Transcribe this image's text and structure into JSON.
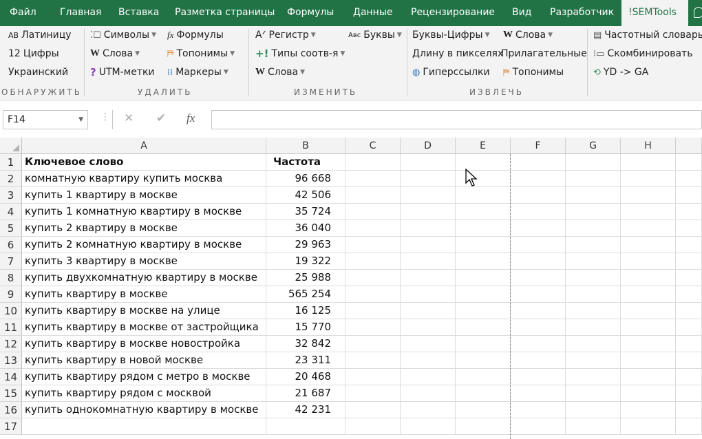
{
  "menu": {
    "tabs": [
      {
        "label": "Файл"
      },
      {
        "label": "Главная"
      },
      {
        "label": "Вставка"
      },
      {
        "label": "Разметка страницы"
      },
      {
        "label": "Формулы"
      },
      {
        "label": "Данные"
      },
      {
        "label": "Рецензирование"
      },
      {
        "label": "Вид"
      },
      {
        "label": "Разработчик"
      },
      {
        "label": "!SEMTools"
      }
    ],
    "active_tab": "!SEMTools"
  },
  "ribbon": {
    "groups": [
      {
        "title": "ОБНАРУЖИТЬ"
      },
      {
        "title": "УДАЛИТЬ"
      },
      {
        "title": "ИЗМЕНИТЬ"
      },
      {
        "title": "ИЗВЛЕЧЬ"
      }
    ],
    "buttons": [
      {
        "label": "Латиницу",
        "icon": "АВ"
      },
      {
        "label": "Цифры",
        "icon": "12"
      },
      {
        "label": "Украинский"
      },
      {
        "label": "Символы",
        "icon": "квадрат"
      },
      {
        "label": "Слова",
        "icon": "W"
      },
      {
        "label": "UTM-метки",
        "icon": "?"
      },
      {
        "label": "Формулы",
        "icon": "fx"
      },
      {
        "label": "Топонимы",
        "icon": "указатель"
      },
      {
        "label": "Маркеры",
        "icon": "маркеры"
      },
      {
        "label": "Регистр",
        "icon": "А"
      },
      {
        "label": "Типы соотв-я",
        "icon": "+!"
      },
      {
        "label": "Слова",
        "icon": "W"
      },
      {
        "label": "Буквы",
        "icon": "Авс"
      },
      {
        "label": "Буквы-Цифры"
      },
      {
        "label": "Длину в пикселях"
      },
      {
        "label": "Гиперссылки",
        "icon": "глобус"
      },
      {
        "label": "Слова",
        "icon": "W"
      },
      {
        "label": "Прилагательные"
      },
      {
        "label": "Топонимы",
        "icon": "указатель"
      },
      {
        "label": "Частотный словарь",
        "icon": "документ"
      },
      {
        "label": "Скомбинировать",
        "icon": "комбинация"
      },
      {
        "label": "YD -> GA",
        "icon": "обновить"
      }
    ]
  },
  "formula_bar": {
    "name_box": "F14",
    "fx_label": "fx",
    "value": ""
  },
  "sheet": {
    "columns": [
      "A",
      "B",
      "C",
      "D",
      "E",
      "F",
      "G",
      "H"
    ],
    "rows": [
      {
        "num": "1",
        "a": "Ключевое слово",
        "b": "Частота"
      },
      {
        "num": "2",
        "a": "комнатную квартиру купить москва",
        "b": "96 668"
      },
      {
        "num": "3",
        "a": "купить 1 квартиру в москве",
        "b": "42 506"
      },
      {
        "num": "4",
        "a": "купить 1 комнатную квартиру в москве",
        "b": "35 724"
      },
      {
        "num": "5",
        "a": "купить 2 квартиру в москве",
        "b": "36 040"
      },
      {
        "num": "6",
        "a": "купить 2 комнатную квартиру в москве",
        "b": "29 963"
      },
      {
        "num": "7",
        "a": "купить 3 квартиру в москве",
        "b": "19 322"
      },
      {
        "num": "8",
        "a": "купить двухкомнатную квартиру в москве",
        "b": "25 988"
      },
      {
        "num": "9",
        "a": "купить квартиру в москве",
        "b": "565 254"
      },
      {
        "num": "10",
        "a": "купить квартиру в москве на улице",
        "b": "16 125"
      },
      {
        "num": "11",
        "a": "купить квартиру в москве от застройщика",
        "b": "15 770"
      },
      {
        "num": "12",
        "a": "купить квартиру в москве новостройка",
        "b": "32 842"
      },
      {
        "num": "13",
        "a": "купить квартиру в новой москве",
        "b": "23 311"
      },
      {
        "num": "14",
        "a": "купить квартиру рядом с метро в москве",
        "b": "20 468"
      },
      {
        "num": "15",
        "a": "купить квартиру рядом с москвой",
        "b": "21 687"
      },
      {
        "num": "16",
        "a": "купить однокомнатную квартиру в москве",
        "b": "42 231"
      },
      {
        "num": "17",
        "a": "",
        "b": ""
      }
    ]
  },
  "colors": {
    "accent": "#217346",
    "ribbon_bg": "#f3f3f3"
  }
}
